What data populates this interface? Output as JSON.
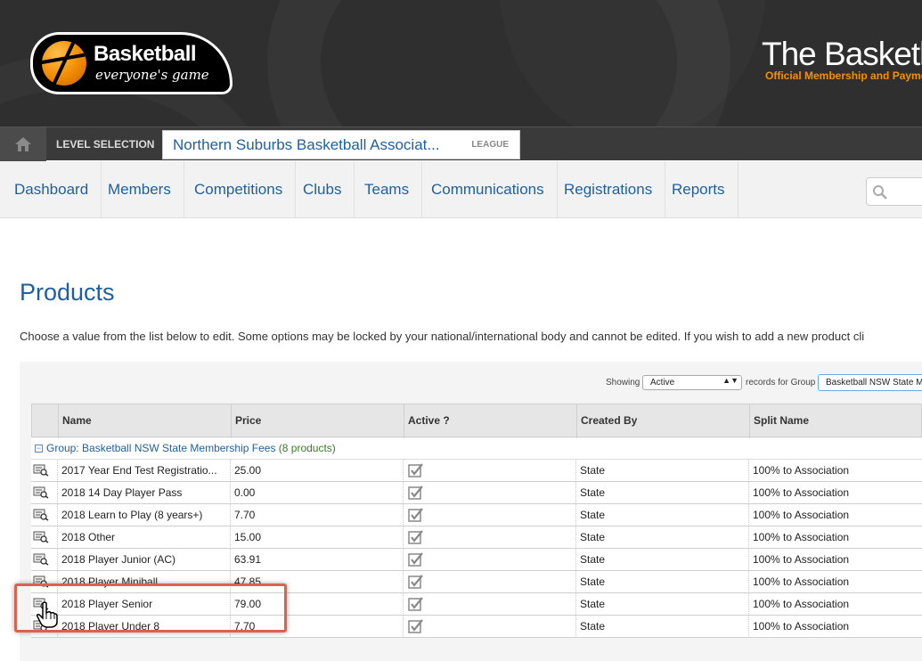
{
  "header": {
    "logo_word": "Basketball",
    "logo_tagline": "everyone's game",
    "brand_title": "The Basketb",
    "brand_subtitle": "Official Membership and Paymen"
  },
  "level_bar": {
    "label": "LEVEL SELECTION",
    "organisation": "Northern Suburbs Basketball Associat...",
    "badge": "LEAGUE"
  },
  "nav": {
    "items": [
      "Dashboard",
      "Members",
      "Competitions",
      "Clubs",
      "Teams",
      "Communications",
      "Registrations",
      "Reports"
    ]
  },
  "page": {
    "title": "Products",
    "intro": "Choose a value from the list below to edit. Some options may be locked by your national/international body and cannot be edited. If you wish to add a new product cli"
  },
  "filter": {
    "showing_label": "Showing",
    "showing_value": "Active",
    "records_label": "records for Group",
    "group_value": "Basketball NSW State M"
  },
  "table": {
    "columns": [
      "Name",
      "Price",
      "Active ?",
      "Created By",
      "Split Name"
    ],
    "group_label": "Group: Basketball NSW State Membership Fees",
    "group_count": "(8 products)",
    "rows": [
      {
        "name": "2017 Year End Test Registratio...",
        "price": "25.00",
        "created_by": "State",
        "split": "100% to Association"
      },
      {
        "name": "2018 14 Day Player Pass",
        "price": "0.00",
        "created_by": "State",
        "split": "100% to Association"
      },
      {
        "name": "2018 Learn to Play (8 years+)",
        "price": "7.70",
        "created_by": "State",
        "split": "100% to Association"
      },
      {
        "name": "2018 Other",
        "price": "15.00",
        "created_by": "State",
        "split": "100% to Association"
      },
      {
        "name": "2018 Player Junior (AC)",
        "price": "63.91",
        "created_by": "State",
        "split": "100% to Association"
      },
      {
        "name": "2018 Player Miniball",
        "price": "47.85",
        "created_by": "State",
        "split": "100% to Association"
      },
      {
        "name": "2018 Player Senior",
        "price": "79.00",
        "created_by": "State",
        "split": "100% to Association"
      },
      {
        "name": "2018 Player Under 8",
        "price": "7.70",
        "created_by": "State",
        "split": "100% to Association"
      }
    ]
  },
  "colors": {
    "link_blue": "#1f5f9e",
    "accent_orange": "#f39200",
    "highlight_red": "#e06050"
  }
}
